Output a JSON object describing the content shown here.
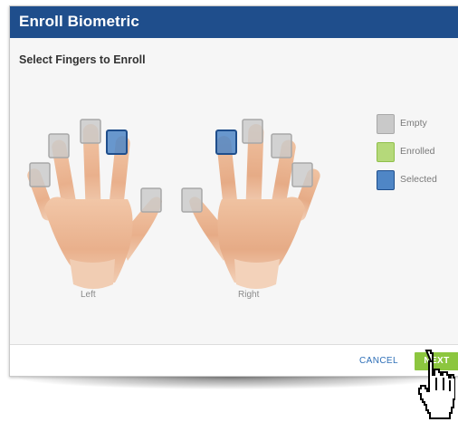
{
  "dialog": {
    "title": "Enroll Biometric",
    "subtitle": "Select Fingers to Enroll"
  },
  "hands": {
    "left_label": "Left",
    "right_label": "Right",
    "left_fingers": [
      {
        "finger": "pinky",
        "state": "empty"
      },
      {
        "finger": "ring",
        "state": "empty"
      },
      {
        "finger": "middle",
        "state": "empty"
      },
      {
        "finger": "index",
        "state": "selected"
      },
      {
        "finger": "thumb",
        "state": "empty"
      }
    ],
    "right_fingers": [
      {
        "finger": "thumb",
        "state": "empty"
      },
      {
        "finger": "index",
        "state": "selected"
      },
      {
        "finger": "middle",
        "state": "empty"
      },
      {
        "finger": "ring",
        "state": "empty"
      },
      {
        "finger": "pinky",
        "state": "empty"
      }
    ]
  },
  "legend": [
    {
      "label": "Empty",
      "fill": "#c9c9c9",
      "border": "#a8a8a8"
    },
    {
      "label": "Enrolled",
      "fill": "#b5d97a",
      "border": "#8fbf4a"
    },
    {
      "label": "Selected",
      "fill": "#4f86c6",
      "border": "#1f4e8c"
    }
  ],
  "footer": {
    "cancel_label": "CANCEL",
    "next_label": "NEXT"
  },
  "colors": {
    "titlebar": "#1f4e8c",
    "next_button": "#8cc63f",
    "cancel_text": "#2e6fb7"
  },
  "icons": {
    "cursor": "hand-pointer-icon"
  }
}
